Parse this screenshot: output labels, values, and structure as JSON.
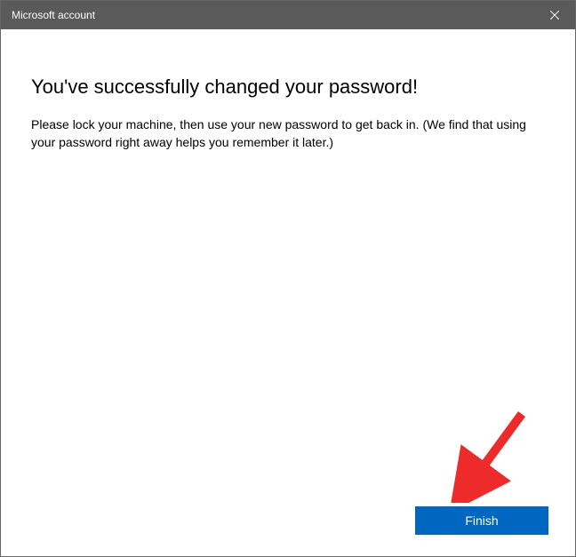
{
  "titlebar": {
    "title": "Microsoft account"
  },
  "content": {
    "heading": "You've successfully changed your password!",
    "body": "Please lock your machine, then use your new password to get back in. (We find that using your password right away helps you remember it later.)"
  },
  "footer": {
    "finish_label": "Finish"
  }
}
